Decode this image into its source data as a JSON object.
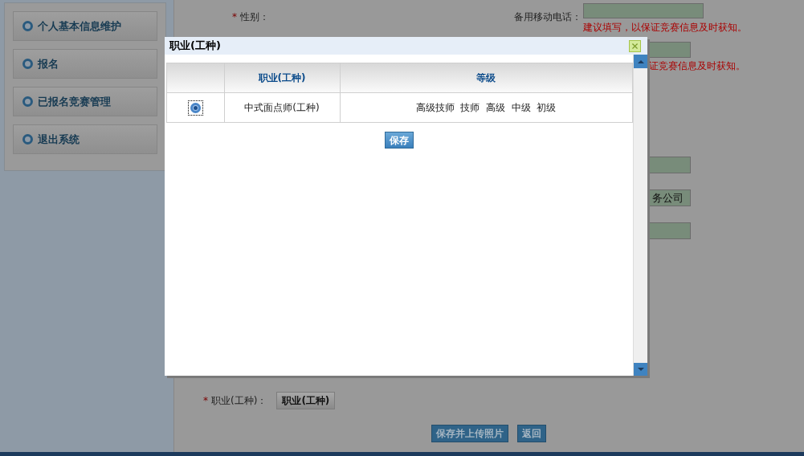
{
  "sidebar": {
    "items": [
      {
        "label": "个人基本信息维护"
      },
      {
        "label": "报名"
      },
      {
        "label": "已报名竞赛管理"
      },
      {
        "label": "退出系统"
      }
    ]
  },
  "form": {
    "gender": {
      "required_mark": "*",
      "label": "性别："
    },
    "backup_mobile": {
      "label": "备用移动电话：",
      "hint": "建议填写，以保证竞赛信息及时获知。"
    },
    "second_hint": "证竞赛信息及时获知。",
    "partial_fields": [
      {
        "kind": "empty"
      },
      {
        "kind": "text",
        "value": "务公司"
      },
      {
        "kind": "empty"
      }
    ],
    "occupation": {
      "required_mark": "*",
      "label": "职业(工种)：",
      "button": "职业(工种)"
    }
  },
  "actions": [
    "保存并上传照片",
    "返回"
  ],
  "dialog": {
    "title": "职业(工种)",
    "table": {
      "columns": [
        "职业(工种)",
        "等级"
      ],
      "rows": [
        {
          "selected": true,
          "occupation": "中式面点师(工种)",
          "levels": "高级技师  技师  高级  中级  初级"
        }
      ]
    },
    "save_button": "保存"
  }
}
